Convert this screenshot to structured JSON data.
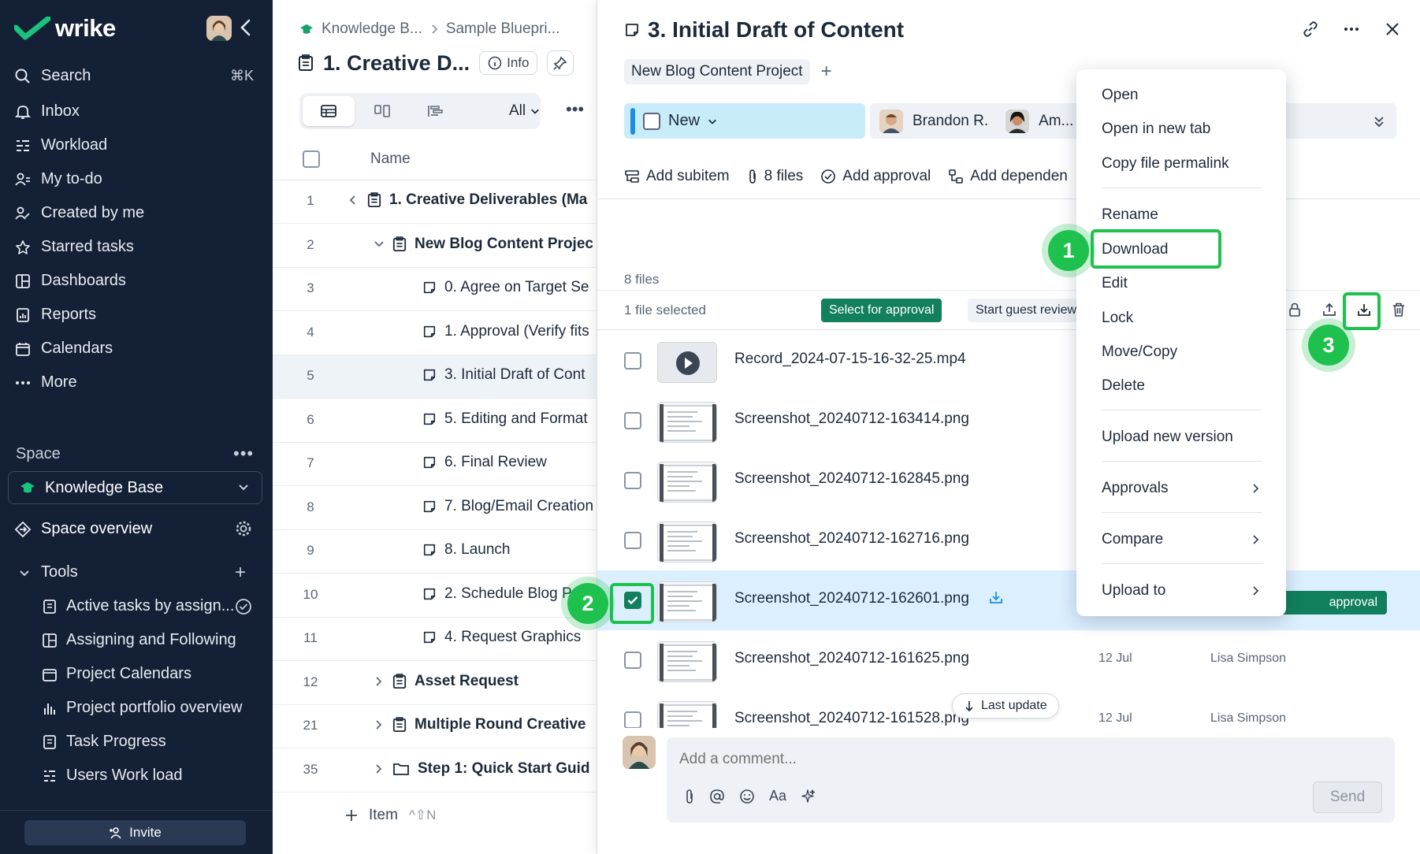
{
  "app": {
    "logo_text": "wrike"
  },
  "sidebar": {
    "search": "Search",
    "search_shortcut": "⌘K",
    "nav": [
      "Inbox",
      "Workload",
      "My to-do",
      "Created by me",
      "Starred tasks",
      "Dashboards",
      "Reports",
      "Calendars",
      "More"
    ],
    "space_label": "Space",
    "space_more": "•••",
    "space_name": "Knowledge Base",
    "space_overview": "Space overview",
    "tools_label": "Tools",
    "tools": [
      "Active tasks by assign...",
      "Assigning and Following",
      "Project Calendars",
      "Project portfolio overview",
      "Task Progress",
      "Users Work load"
    ],
    "invite": "Invite"
  },
  "middle": {
    "breadcrumb": [
      "Knowledge B...",
      "Sample Bluepri..."
    ],
    "title": "1. Creative D...",
    "info": "Info",
    "view_all": "All",
    "col_name": "Name",
    "rows": [
      {
        "num": "1",
        "label": "1. Creative Deliverables (Ma",
        "bold": true
      },
      {
        "num": "2",
        "label": "New Blog Content Projec",
        "bold": true
      },
      {
        "num": "3",
        "label": "0. Agree on Target Se",
        "bold": false
      },
      {
        "num": "4",
        "label": "1. Approval (Verify fits",
        "bold": false
      },
      {
        "num": "5",
        "label": "3. Initial Draft of Cont",
        "bold": false
      },
      {
        "num": "6",
        "label": "5. Editing and Format",
        "bold": false
      },
      {
        "num": "7",
        "label": "6. Final Review",
        "bold": false
      },
      {
        "num": "8",
        "label": "7. Blog/Email Creation",
        "bold": false
      },
      {
        "num": "9",
        "label": "8. Launch",
        "bold": false
      },
      {
        "num": "10",
        "label": "2. Schedule Blog P",
        "bold": false
      },
      {
        "num": "11",
        "label": "4. Request Graphics",
        "bold": false
      },
      {
        "num": "12",
        "label": "Asset Request",
        "bold": true
      },
      {
        "num": "21",
        "label": "Multiple Round Creative",
        "bold": true
      },
      {
        "num": "35",
        "label": "Step 1: Quick Start Guid",
        "bold": true
      }
    ],
    "add_item": "Item",
    "add_item_kbd": "^⇧N"
  },
  "detail": {
    "title": "3. Initial Draft of Content",
    "tag": "New Blog Content Project",
    "status": "New",
    "assignee1": "Brandon R.",
    "assignee2": "Am...",
    "actions": [
      "Add subitem",
      "8 files",
      "Add approval",
      "Add dependen"
    ],
    "files_count": "8 files",
    "selected_count": "1 file selected",
    "select_for_approval": "Select for approval",
    "start_guest_review": "Start guest review",
    "approval_pill": "approval",
    "files": [
      {
        "name": "Record_2024-07-15-16-32-25.mp4",
        "date": "",
        "user": "",
        "selected": false,
        "video": true
      },
      {
        "name": "Screenshot_20240712-163414.png",
        "date": "",
        "user": "",
        "selected": false
      },
      {
        "name": "Screenshot_20240712-162845.png",
        "date": "",
        "user": "",
        "selected": false
      },
      {
        "name": "Screenshot_20240712-162716.png",
        "date": "",
        "user": "",
        "selected": false
      },
      {
        "name": "Screenshot_20240712-162601.png",
        "date": "",
        "user": "",
        "selected": true
      },
      {
        "name": "Screenshot_20240712-161625.png",
        "date": "12 Jul",
        "user": "Lisa Simpson",
        "selected": false
      },
      {
        "name": "Screenshot_20240712-161528.png",
        "date": "12 Jul",
        "user": "Lisa Simpson",
        "selected": false
      }
    ],
    "last_update": "Last update",
    "comment_placeholder": "Add a comment...",
    "send": "Send",
    "text_format": "Aa"
  },
  "context_menu": {
    "items": [
      "Open",
      "Open in new tab",
      "Copy file permalink",
      "Rename",
      "Download",
      "Edit",
      "Lock",
      "Move/Copy",
      "Delete",
      "Upload new version",
      "Approvals",
      "Compare",
      "Upload to"
    ]
  },
  "annotations": {
    "step1": "1",
    "step2": "2",
    "step3": "3"
  },
  "colors": {
    "sidebar_bg": "#142035",
    "accent_green": "#12805c",
    "highlight_green": "#1ec14e",
    "status_blue": "#c9ecfb",
    "selected_row": "#dcefff"
  }
}
